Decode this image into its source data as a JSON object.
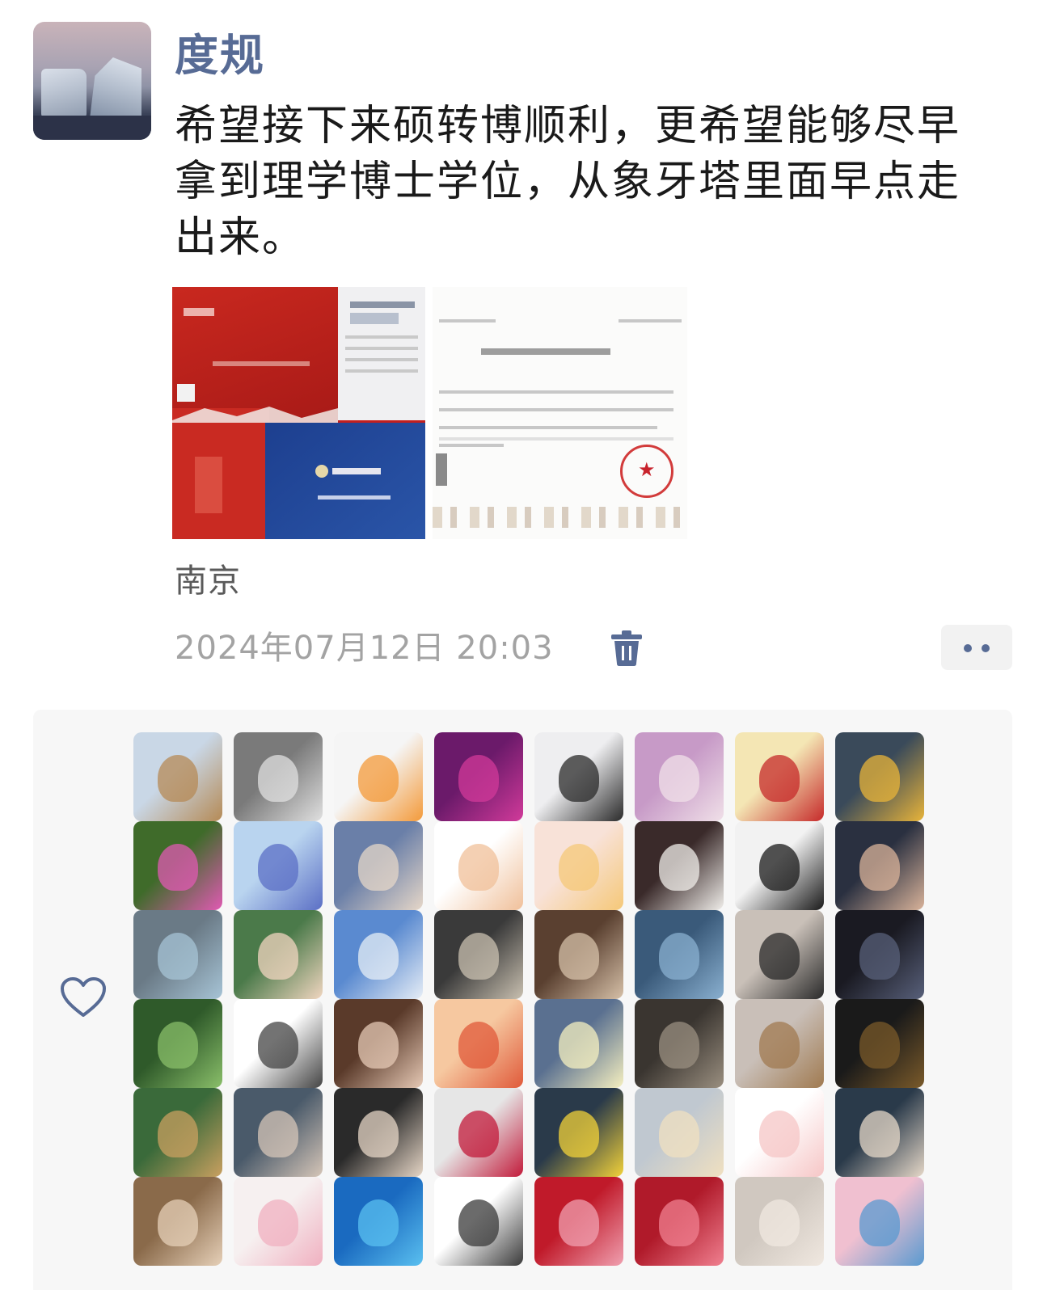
{
  "post": {
    "author": "度规",
    "content": "希望接下来硕转博顺利，更希望能够尽早拿到理学博士学位，从象牙塔里面早点走出来。",
    "location": "南京",
    "timestamp": "2024年07月12日 20:03",
    "icons": {
      "delete": "trash-icon",
      "more": "more-dots-icon",
      "like": "heart-outline-icon"
    },
    "colors": {
      "author": "#576b95",
      "accent": "#576b95"
    }
  },
  "likers": [
    {
      "c1": "#c9d7e6",
      "c2": "#b58a55"
    },
    {
      "c1": "#7a7a7a",
      "c2": "#e0e0e0"
    },
    {
      "c1": "#f5f5f5",
      "c2": "#f39a3a"
    },
    {
      "c1": "#6b1a6a",
      "c2": "#d13a9a"
    },
    {
      "c1": "#eeeef0",
      "c2": "#2a2a2a"
    },
    {
      "c1": "#c79ac7",
      "c2": "#f0e0e8"
    },
    {
      "c1": "#f4e6b4",
      "c2": "#c62a2a"
    },
    {
      "c1": "#3a4a5a",
      "c2": "#e8b43a"
    },
    {
      "c1": "#3f6b2a",
      "c2": "#e05ab3"
    },
    {
      "c1": "#b9d4ef",
      "c2": "#5b6fc5"
    },
    {
      "c1": "#6a7fa8",
      "c2": "#e6d7c8"
    },
    {
      "c1": "#ffffff",
      "c2": "#f0c09a"
    },
    {
      "c1": "#f8e2d8",
      "c2": "#f5c878"
    },
    {
      "c1": "#3a2a2a",
      "c2": "#f0eeea"
    },
    {
      "c1": "#f2f2f2",
      "c2": "#1a1a1a"
    },
    {
      "c1": "#2a3040",
      "c2": "#d9b39a"
    },
    {
      "c1": "#6a7a86",
      "c2": "#a7c4d6"
    },
    {
      "c1": "#4b7a4a",
      "c2": "#f1d6c0"
    },
    {
      "c1": "#5a8ad0",
      "c2": "#e6edf6"
    },
    {
      "c1": "#3a3a3a",
      "c2": "#c9c0b0"
    },
    {
      "c1": "#5a4030",
      "c2": "#d6c0a8"
    },
    {
      "c1": "#3a5a7a",
      "c2": "#8ab0d0"
    },
    {
      "c1": "#c9c0b8",
      "c2": "#2a2a2a"
    },
    {
      "c1": "#1a1a22",
      "c2": "#58607a"
    },
    {
      "c1": "#2f5a2a",
      "c2": "#8abf6a"
    },
    {
      "c1": "#ffffff",
      "c2": "#444444"
    },
    {
      "c1": "#5a3a2a",
      "c2": "#e6c9b5"
    },
    {
      "c1": "#f6c8a0",
      "c2": "#e05a3a"
    },
    {
      "c1": "#5a7090",
      "c2": "#f6f0c0"
    },
    {
      "c1": "#3a3530",
      "c2": "#9a8f80"
    },
    {
      "c1": "#c9bfb8",
      "c2": "#a07a50"
    },
    {
      "c1": "#1a1a1a",
      "c2": "#7a5a2a"
    },
    {
      "c1": "#3a6a3a",
      "c2": "#c9a060"
    },
    {
      "c1": "#4a5a6a",
      "c2": "#d6c6b8"
    },
    {
      "c1": "#2a2a2a",
      "c2": "#e6d6c6"
    },
    {
      "c1": "#e6e6e6",
      "c2": "#c21a3a"
    },
    {
      "c1": "#2a3a4a",
      "c2": "#f2d23a"
    },
    {
      "c1": "#c0c8d0",
      "c2": "#f0e0c0"
    },
    {
      "c1": "#ffffff",
      "c2": "#f6c6c6"
    },
    {
      "c1": "#2a3a4a",
      "c2": "#e6d8c8"
    },
    {
      "c1": "#8a6a4a",
      "c2": "#e6d0b8"
    },
    {
      "c1": "#f6f0f0",
      "c2": "#f0b0c0"
    },
    {
      "c1": "#1a6ac0",
      "c2": "#5ac0f0"
    },
    {
      "c1": "#ffffff",
      "c2": "#3a3a3a"
    },
    {
      "c1": "#c01a2a",
      "c2": "#f0a0b0"
    },
    {
      "c1": "#b01a2a",
      "c2": "#f08090"
    },
    {
      "c1": "#d0c8c0",
      "c2": "#f0e8e0"
    },
    {
      "c1": "#f0c0d0",
      "c2": "#5a9ad0"
    }
  ]
}
